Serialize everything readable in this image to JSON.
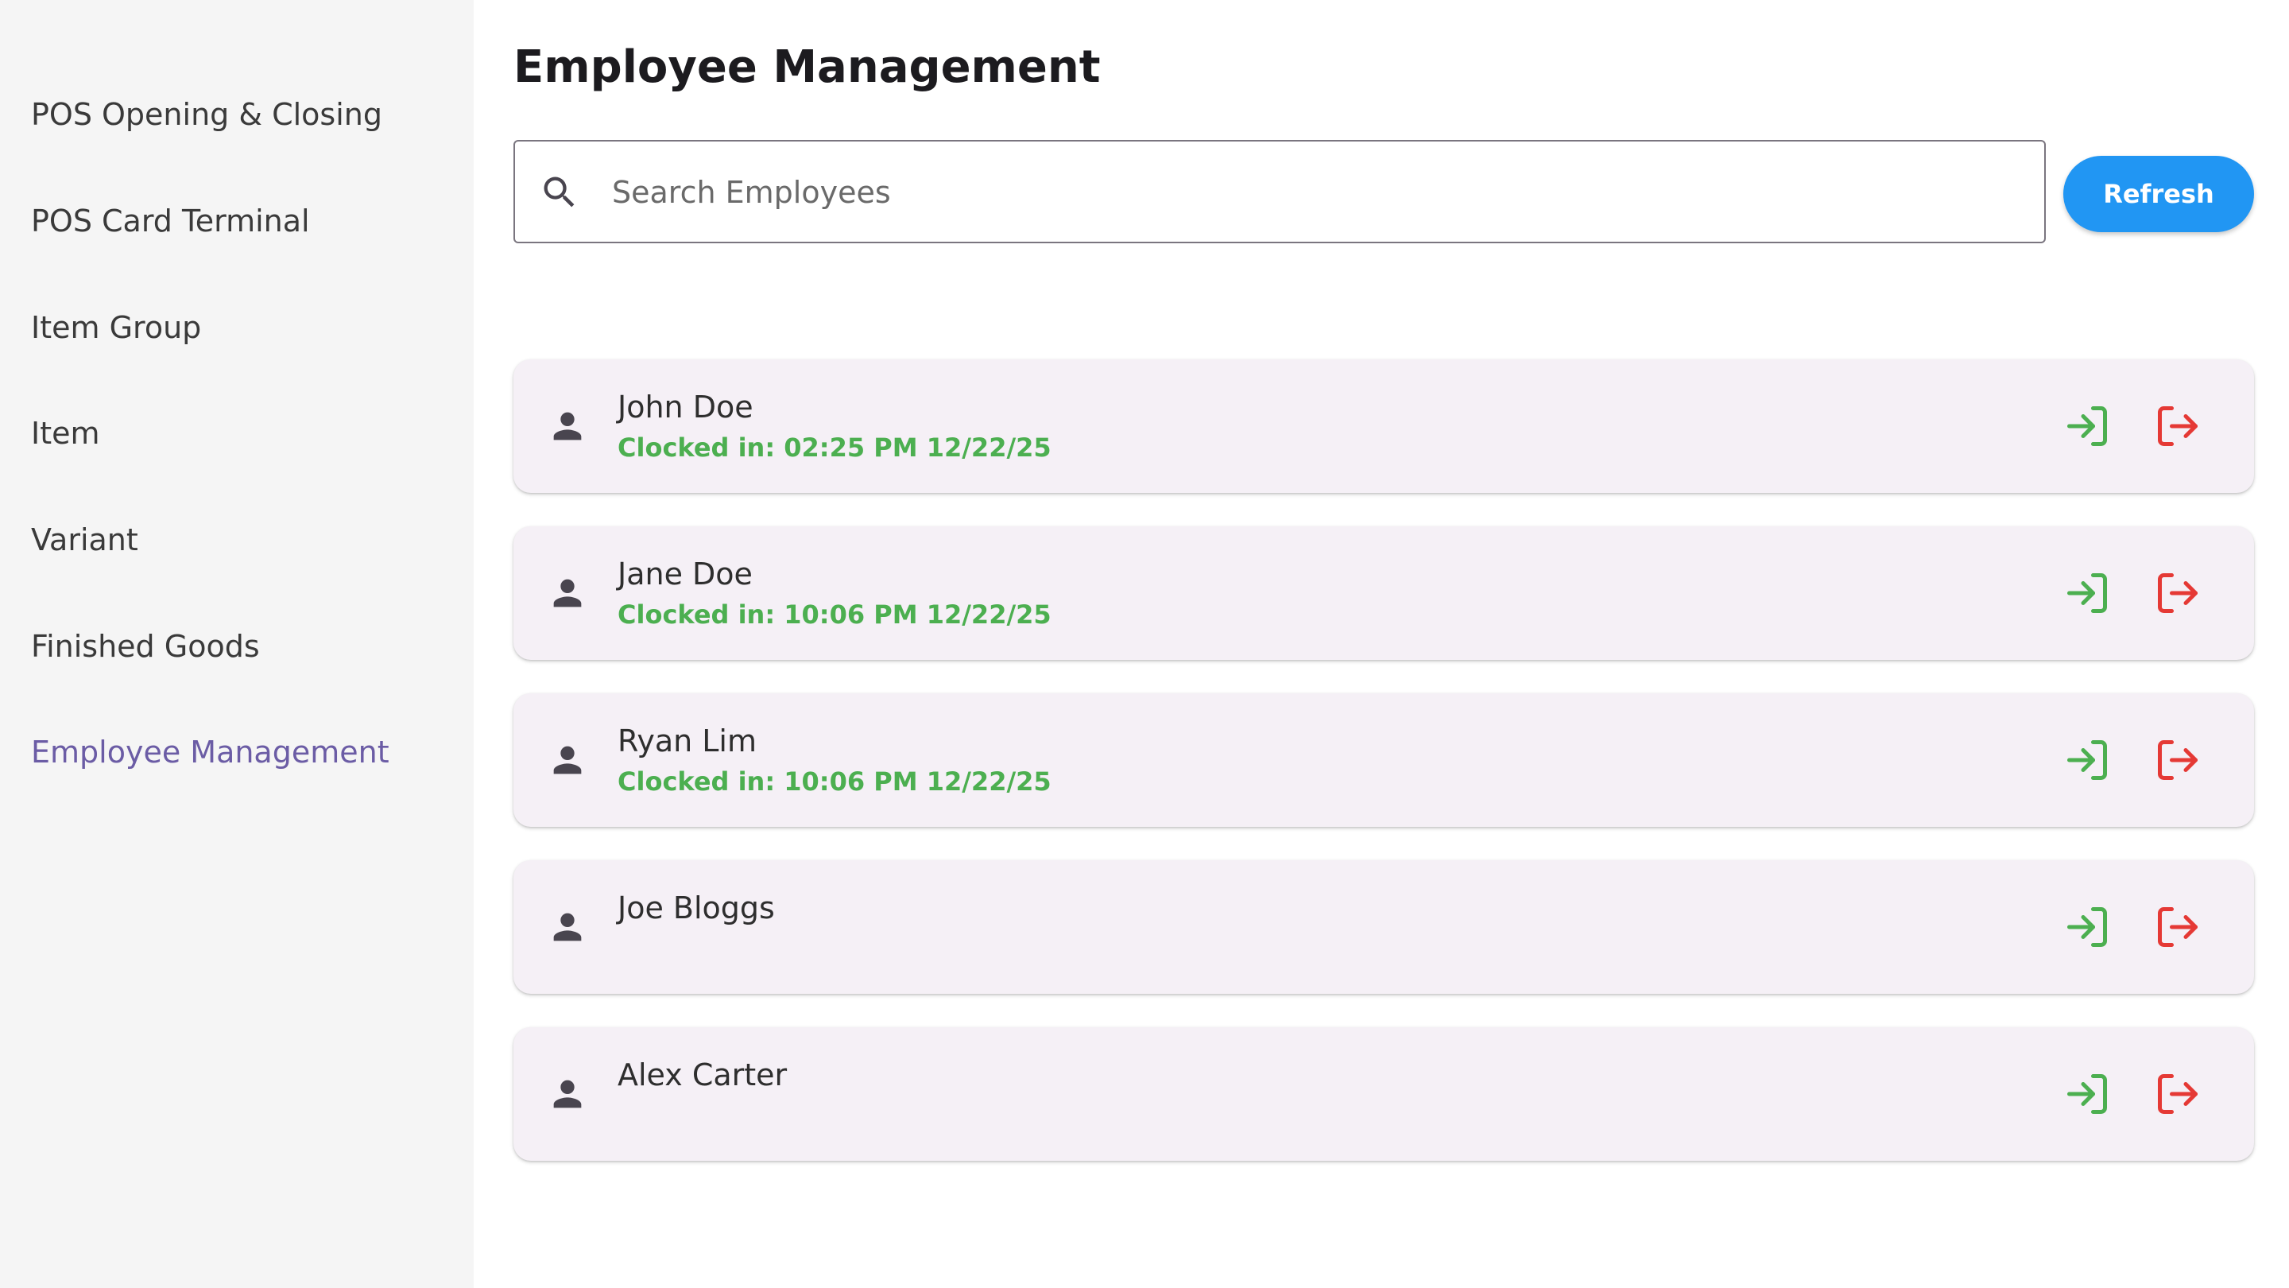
{
  "sidebar": {
    "items": [
      {
        "label": "POS Opening & Closing",
        "active": false
      },
      {
        "label": "POS Card Terminal",
        "active": false
      },
      {
        "label": "Item Group",
        "active": false
      },
      {
        "label": "Item",
        "active": false
      },
      {
        "label": "Variant",
        "active": false
      },
      {
        "label": "Finished Goods",
        "active": false
      },
      {
        "label": "Employee Management",
        "active": true
      }
    ]
  },
  "header": {
    "title": "Employee Management"
  },
  "search": {
    "placeholder": "Search Employees",
    "value": "",
    "icon": "search-icon"
  },
  "toolbar": {
    "refresh_label": "Refresh"
  },
  "employees": [
    {
      "name": "John Doe",
      "status": "Clocked in: 02:25 PM 12/22/25"
    },
    {
      "name": "Jane Doe",
      "status": "Clocked in: 10:06 PM 12/22/25"
    },
    {
      "name": "Ryan Lim",
      "status": "Clocked in: 10:06 PM 12/22/25"
    },
    {
      "name": "Joe Bloggs",
      "status": ""
    },
    {
      "name": "Alex Carter",
      "status": ""
    }
  ],
  "icons": {
    "person": "person-icon",
    "clock_in": "login-icon",
    "clock_out": "logout-icon"
  },
  "colors": {
    "accent": "#2196f3",
    "active_nav": "#6b5ca5",
    "clock_in": "#4caf50",
    "clock_out": "#e53935",
    "card_background": "#f5f0f6",
    "sidebar_background": "#f5f5f5"
  }
}
